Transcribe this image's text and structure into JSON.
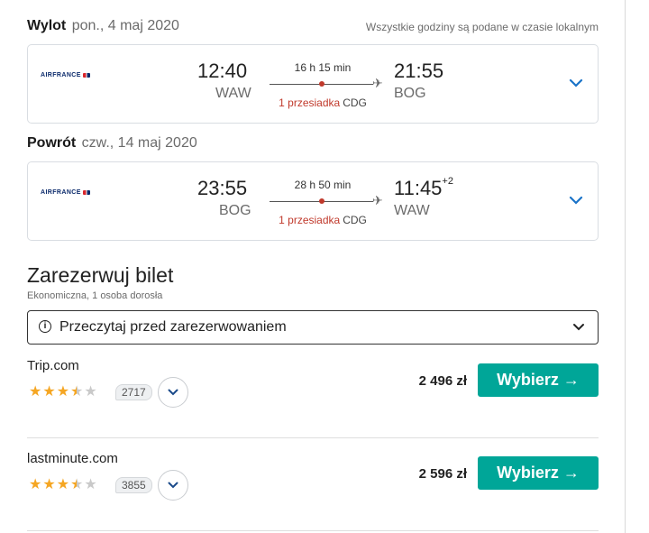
{
  "outbound": {
    "label": "Wylot",
    "date": "pon., 4 maj 2020",
    "timezone_note": "Wszystkie godziny są podane w czasie lokalnym",
    "airline": "AIRFRANCE",
    "depart_time": "12:40",
    "depart_code": "WAW",
    "duration": "16 h 15 min",
    "stops": "1 przesiadka",
    "stop_airport": "CDG",
    "arrive_time": "21:55",
    "arrive_offset": "",
    "arrive_code": "BOG"
  },
  "return": {
    "label": "Powrót",
    "date": "czw., 14 maj 2020",
    "airline": "AIRFRANCE",
    "depart_time": "23:55",
    "depart_code": "BOG",
    "duration": "28 h 50 min",
    "stops": "1 przesiadka",
    "stop_airport": "CDG",
    "arrive_time": "11:45",
    "arrive_offset": "+2",
    "arrive_code": "WAW"
  },
  "booking": {
    "title": "Zarezerwuj bilet",
    "subtitle": "Ekonomiczna, 1 osoba dorosła",
    "notice": "Przeczytaj przed zarezerwowaniem"
  },
  "providers": [
    {
      "name": "Trip.com",
      "rating": 3.5,
      "reviews": "2717",
      "price": "2 496 zł",
      "button": "Wybierz →"
    },
    {
      "name": "lastminute.com",
      "rating": 3.5,
      "reviews": "3855",
      "price": "2 596 zł",
      "button": "Wybierz →"
    }
  ],
  "colors": {
    "accent": "#00a698",
    "link": "#1a73c8",
    "stop": "#c0392b",
    "star": "#f5a623"
  }
}
